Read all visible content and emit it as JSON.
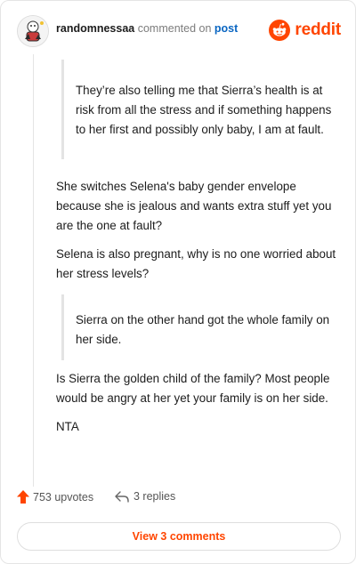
{
  "header": {
    "username": "randomnessaa",
    "action_text": "commented on",
    "post_link": "post",
    "brand": "reddit",
    "avatar_icon": "cartoon-avatar",
    "brand_icon": "reddit-alien-icon",
    "brand_color": "#ff4500"
  },
  "comment": {
    "quote1": "They’re also telling me that Sierra’s health is at risk from all the stress and if something happens to her first and possibly only baby, I am at fault.",
    "para1": "She switches Selena's baby gender envelope because she is jealous and wants extra stuff yet you are the one at fault?",
    "para2": "Selena is also pregnant, why is no one worried about her stress levels?",
    "quote2": "Sierra on the other hand got the whole family on her side.",
    "para3": "Is Sierra the golden child of the family? Most people would be angry at her yet your family is on her side.",
    "para4": "NTA"
  },
  "footer": {
    "upvotes": "753 upvotes",
    "replies": "3 replies",
    "upvote_icon": "upvote-arrow-icon",
    "reply_icon": "reply-arrow-icon",
    "view_button": "View 3 comments"
  }
}
